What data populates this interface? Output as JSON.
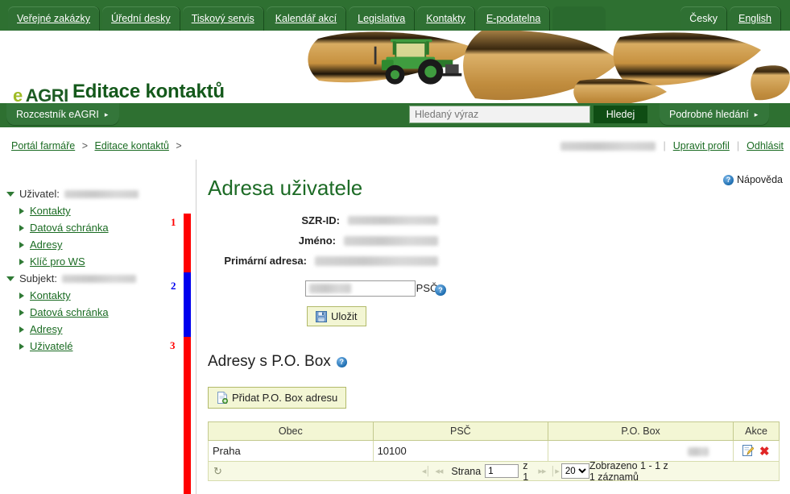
{
  "topnav": {
    "tabs": [
      {
        "label": "Veřejné zakázky"
      },
      {
        "label": "Úřední desky"
      },
      {
        "label": "Tiskový servis"
      },
      {
        "label": "Kalendář akcí"
      },
      {
        "label": "Legislativa"
      },
      {
        "label": "Kontakty"
      },
      {
        "label": "E-podatelna"
      }
    ],
    "lang_current": "Česky",
    "lang_other": "English"
  },
  "banner": {
    "logo_e": "e",
    "logo_agri": "AGRI",
    "app_title": "Editace kontaktů"
  },
  "greenbar": {
    "crossroads_label": "Rozcestník eAGRI",
    "crossroads_arrow": "▸",
    "search_placeholder": "Hledaný výraz",
    "search_value": "",
    "search_button": "Hledej",
    "advanced_label": "Podrobné hledání",
    "advanced_arrow": "▸"
  },
  "breadcrumb": {
    "items": [
      {
        "label": "Portál farmáře"
      },
      {
        "label": "Editace kontaktů"
      }
    ],
    "separator": ">",
    "trailing_separator": ">"
  },
  "userbar": {
    "username_redacted": true,
    "edit_profile": "Upravit profil",
    "logout": "Odhlásit"
  },
  "sidebar": {
    "groups": [
      {
        "label": "Uživatel:",
        "value_redacted": true,
        "items": [
          {
            "label": "Kontakty"
          },
          {
            "label": "Datová schránka"
          },
          {
            "label": "Adresy"
          },
          {
            "label": "Klíč pro WS"
          }
        ]
      },
      {
        "label": "Subjekt:",
        "value_redacted": true,
        "items": [
          {
            "label": "Kontakty"
          },
          {
            "label": "Datová schránka"
          },
          {
            "label": "Adresy"
          },
          {
            "label": "Uživatelé"
          }
        ]
      }
    ]
  },
  "annotations": {
    "markers": [
      {
        "number": "1",
        "color": "#ff0000"
      },
      {
        "number": "2",
        "color": "#0000ee"
      },
      {
        "number": "3",
        "color": "#ff0000"
      }
    ]
  },
  "main": {
    "page_title": "Adresa uživatele",
    "help_link": "Nápověda",
    "help_icon_glyph": "?",
    "fields": [
      {
        "label": "SZR-ID:",
        "value_redacted": true
      },
      {
        "label": "Jméno:",
        "value_redacted": true
      },
      {
        "label": "Primární adresa:",
        "value_redacted": true
      }
    ],
    "special_zip_label": "Speciální PSČ:",
    "special_zip_value": "",
    "save_button": "Uložit",
    "section_title": "Adresy s P.O. Box",
    "add_button": "Přidat P.O. Box adresu"
  },
  "table": {
    "columns": [
      "Obec",
      "PSČ",
      "P.O. Box",
      "Akce"
    ],
    "rows": [
      {
        "obec": "Praha",
        "psc": "10100",
        "po_box_redacted": true
      }
    ],
    "footer": {
      "refresh_glyph": "↻",
      "first_glyph": "◂│",
      "prev_glyph": "◂◂",
      "page_label": "Strana",
      "page_value": "1",
      "page_of": "z 1",
      "next_glyph": "▸▸",
      "last_glyph": "│▸",
      "page_size": "20",
      "page_size_options": [
        "20"
      ],
      "records_info": "Zobrazeno 1 - 1 z 1 záznamů"
    }
  },
  "colors": {
    "header_green": "#2e7031",
    "link_green": "#1a6b22",
    "title_green": "#1d6b26",
    "button_bg": "#f3f6d4",
    "button_border": "#b2ba6a",
    "accent_red": "#ff0000",
    "accent_blue": "#0000ee"
  }
}
